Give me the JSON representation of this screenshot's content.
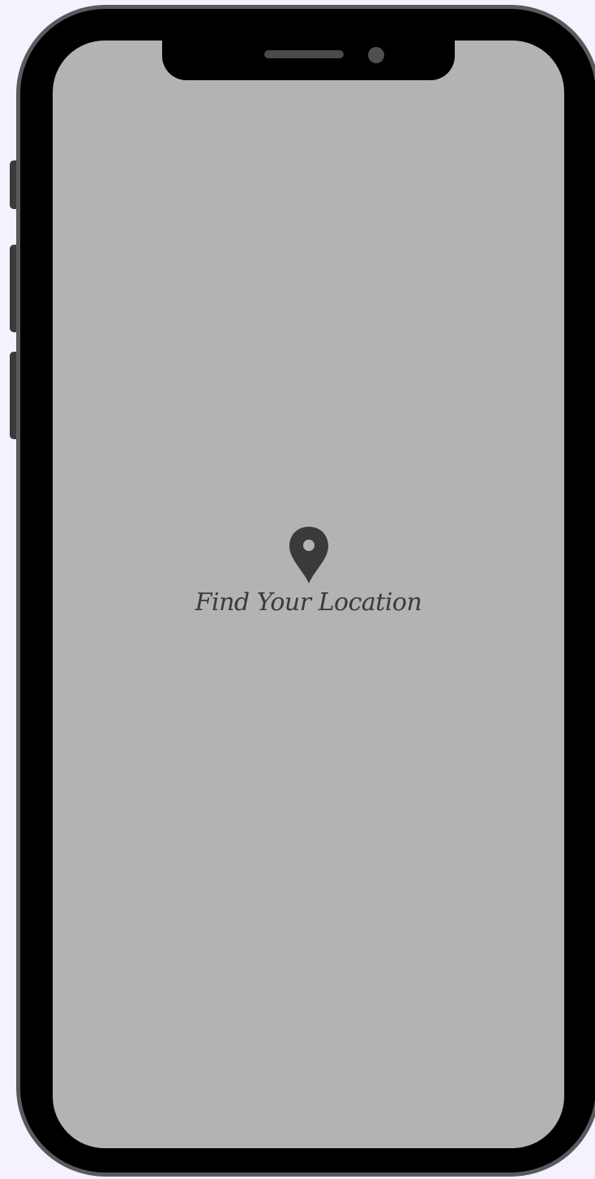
{
  "splash": {
    "tagline": "Find Your Location",
    "icon": "map-pin-icon"
  },
  "colors": {
    "page_background": "#f5f1fd",
    "screen_background": "#b3b3b3",
    "device_frame": "#000000",
    "device_bezel": "#5a5a5e",
    "icon_and_text": "#3a3a3a"
  }
}
